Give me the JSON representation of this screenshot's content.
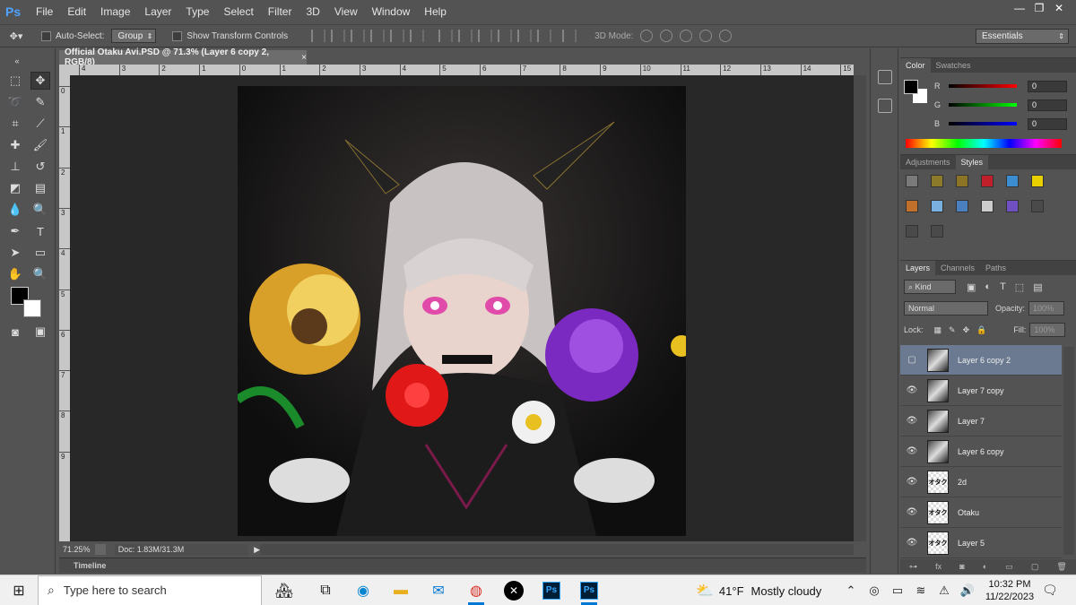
{
  "app": {
    "logo": "Ps"
  },
  "menu": [
    "File",
    "Edit",
    "Image",
    "Layer",
    "Type",
    "Select",
    "Filter",
    "3D",
    "View",
    "Window",
    "Help"
  ],
  "window_controls": {
    "minimize": "—",
    "restore": "❐",
    "close": "✕"
  },
  "options": {
    "auto_select_label": "Auto-Select:",
    "auto_select_value": "Group",
    "transform_label": "Show Transform Controls",
    "mode3d_label": "3D Mode:",
    "workspace": "Essentials"
  },
  "document": {
    "tab_title": "Official Otaku Avi.PSD @ 71.3% (Layer 6 copy 2, RGB/8)",
    "close": "×",
    "zoom": "71.25%",
    "doc_info": "Doc: 1.83M/31.3M",
    "ruler_h": [
      "4",
      "3",
      "2",
      "1",
      "0",
      "1",
      "2",
      "3",
      "4",
      "5",
      "6",
      "7",
      "8",
      "9",
      "10",
      "11",
      "12",
      "13",
      "14",
      "15"
    ],
    "ruler_v": [
      "0",
      "1",
      "2",
      "3",
      "4",
      "5",
      "6",
      "7",
      "8",
      "9"
    ]
  },
  "timeline": {
    "label": "Timeline"
  },
  "color_panel": {
    "tabs": [
      "Color",
      "Swatches"
    ],
    "r_label": "R",
    "g_label": "G",
    "b_label": "B",
    "r": "0",
    "g": "0",
    "b": "0"
  },
  "styles_panel": {
    "tabs": [
      "Adjustments",
      "Styles"
    ],
    "swatches": [
      "#7a7a7a",
      "#8a7a2a",
      "#8c7426",
      "#c0202a",
      "#3c8cd0",
      "#e8d000",
      "#c0702a",
      "#7ab0e0",
      "#4a80c0",
      "#cccccc",
      "#7050c0",
      "#4a4a4a",
      "#4a4a4a",
      "#4a4a4a"
    ]
  },
  "layers_panel": {
    "tabs": [
      "Layers",
      "Channels",
      "Paths"
    ],
    "kind": "Kind",
    "blend_mode": "Normal",
    "opacity_label": "Opacity:",
    "opacity_value": "100%",
    "lock_label": "Lock:",
    "fill_label": "Fill:",
    "fill_value": "100%",
    "layers": [
      {
        "name": "Layer 6 copy 2",
        "visible": false,
        "selected": true,
        "thumb": "dark"
      },
      {
        "name": "Layer 7 copy",
        "visible": true,
        "selected": false,
        "thumb": "dark"
      },
      {
        "name": "Layer 7",
        "visible": true,
        "selected": false,
        "thumb": "dark"
      },
      {
        "name": "Layer 6 copy",
        "visible": true,
        "selected": false,
        "thumb": "dark"
      },
      {
        "name": "2d",
        "visible": true,
        "selected": false,
        "thumb": "text"
      },
      {
        "name": "Otaku",
        "visible": true,
        "selected": false,
        "thumb": "text"
      },
      {
        "name": "Layer 5",
        "visible": true,
        "selected": false,
        "thumb": "text"
      }
    ],
    "thumb_text": "オタク"
  },
  "taskbar": {
    "search_placeholder": "Type here to search",
    "weather_temp": "41°F",
    "weather_desc": "Mostly cloudy",
    "time": "10:32 PM",
    "date": "11/22/2023",
    "ps_label": "Ps"
  }
}
